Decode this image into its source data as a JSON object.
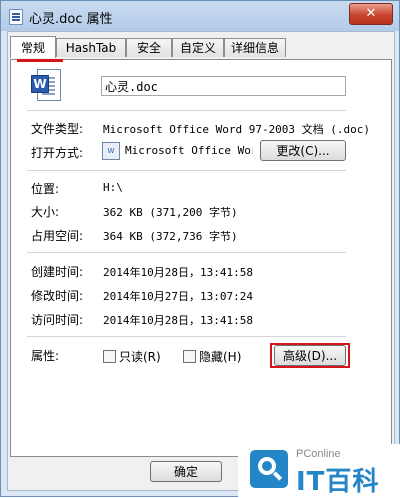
{
  "window": {
    "title": "心灵.doc 属性",
    "close_label": "✕"
  },
  "tabs": [
    {
      "label": "常规",
      "active": true
    },
    {
      "label": "HashTab",
      "active": false
    },
    {
      "label": "安全",
      "active": false
    },
    {
      "label": "自定义",
      "active": false
    },
    {
      "label": "详细信息",
      "active": false
    }
  ],
  "general": {
    "file_icon": "word-document-icon",
    "file_name": "心灵.doc",
    "file_type_label": "文件类型:",
    "file_type_value": "Microsoft Office Word 97-2003 文档 (.doc)",
    "open_with_label": "打开方式:",
    "open_with_icon": "word-app-icon",
    "open_with_value": "Microsoft Office Word",
    "change_button": "更改(C)...",
    "location_label": "位置:",
    "location_value": "H:\\",
    "size_label": "大小:",
    "size_value": "362 KB (371,200 字节)",
    "disk_size_label": "占用空间:",
    "disk_size_value": "364 KB (372,736 字节)",
    "created_label": "创建时间:",
    "created_value": "2014年10月28日，13:41:58",
    "modified_label": "修改时间:",
    "modified_value": "2014年10月27日，13:07:24",
    "accessed_label": "访问时间:",
    "accessed_value": "2014年10月28日，13:41:58",
    "attributes_label": "属性:",
    "readonly_label": "只读(R)",
    "readonly_checked": false,
    "hidden_label": "隐藏(H)",
    "hidden_checked": false,
    "advanced_button": "高级(D)..."
  },
  "footer": {
    "ok_button": "确定"
  },
  "watermark": {
    "small": "PConline",
    "big": "IT百科"
  },
  "colors": {
    "highlight_red": "#d6141c",
    "watermark_blue": "#2485c7"
  }
}
